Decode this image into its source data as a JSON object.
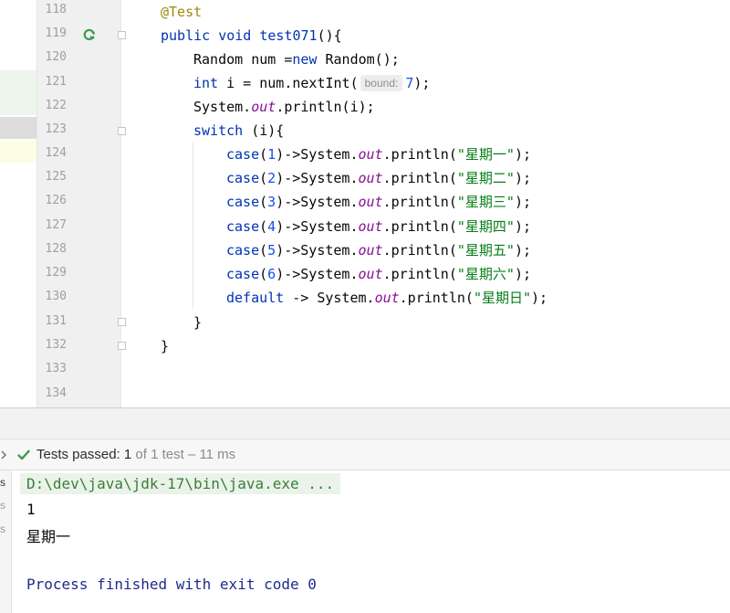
{
  "editor": {
    "line_numbers": [
      "118",
      "119",
      "120",
      "121",
      "122",
      "123",
      "124",
      "125",
      "126",
      "127",
      "128",
      "129",
      "130",
      "131",
      "132",
      "133",
      "134"
    ],
    "line_118": {
      "annotation": "@Test"
    },
    "line_119": {
      "kw1": "public",
      "kw2": "void",
      "method": "test071",
      "rest": "(){"
    },
    "line_120": {
      "pre": "Random num =",
      "kw": "new",
      "post": " Random();"
    },
    "line_121": {
      "kw": "int",
      "pre": " i = num.nextInt(",
      "hint": "bound:",
      "num": "7",
      "post": ");"
    },
    "line_122": {
      "pre": "System.",
      "fld": "out",
      "post": ".println(i);"
    },
    "line_123": {
      "kw": "switch",
      "post": " (i){"
    },
    "cases": [
      {
        "kw": "case",
        "open": "(",
        "num": "1",
        "mid": ")->System.",
        "fld": "out",
        "call": ".println(",
        "str": "\"星期一\"",
        "end": ");"
      },
      {
        "kw": "case",
        "open": "(",
        "num": "2",
        "mid": ")->System.",
        "fld": "out",
        "call": ".println(",
        "str": "\"星期二\"",
        "end": ");"
      },
      {
        "kw": "case",
        "open": "(",
        "num": "3",
        "mid": ")->System.",
        "fld": "out",
        "call": ".println(",
        "str": "\"星期三\"",
        "end": ");"
      },
      {
        "kw": "case",
        "open": "(",
        "num": "4",
        "mid": ")->System.",
        "fld": "out",
        "call": ".println(",
        "str": "\"星期四\"",
        "end": ");"
      },
      {
        "kw": "case",
        "open": "(",
        "num": "5",
        "mid": ")->System.",
        "fld": "out",
        "call": ".println(",
        "str": "\"星期五\"",
        "end": ");"
      },
      {
        "kw": "case",
        "open": "(",
        "num": "6",
        "mid": ")->System.",
        "fld": "out",
        "call": ".println(",
        "str": "\"星期六\"",
        "end": ");"
      }
    ],
    "line_130": {
      "kw": "default",
      "mid": " -> System.",
      "fld": "out",
      "call": ".println(",
      "str": "\"星期日\"",
      "end": ");"
    },
    "line_131": {
      "text": "}"
    },
    "line_132": {
      "text": "}"
    }
  },
  "run_panel": {
    "status": "Tests passed:",
    "count": "1",
    "detail": "of 1 test – 11 ms",
    "check_icon": "check-icon",
    "chevron_icon": "chevron-right-icon"
  },
  "console": {
    "command": "D:\\dev\\java\\jdk-17\\bin\\java.exe ...",
    "output_1": "1",
    "output_2": "星期一",
    "finish": "Process finished with exit code 0",
    "side_marks": [
      "s",
      "s",
      "s"
    ]
  },
  "colors": {
    "keyword": "#0033b3",
    "annotation": "#9e880d",
    "field": "#871094",
    "string": "#067d17",
    "number": "#1750eb",
    "passed_green": "#3e9b4f",
    "console_blue": "#1f2a8c"
  }
}
